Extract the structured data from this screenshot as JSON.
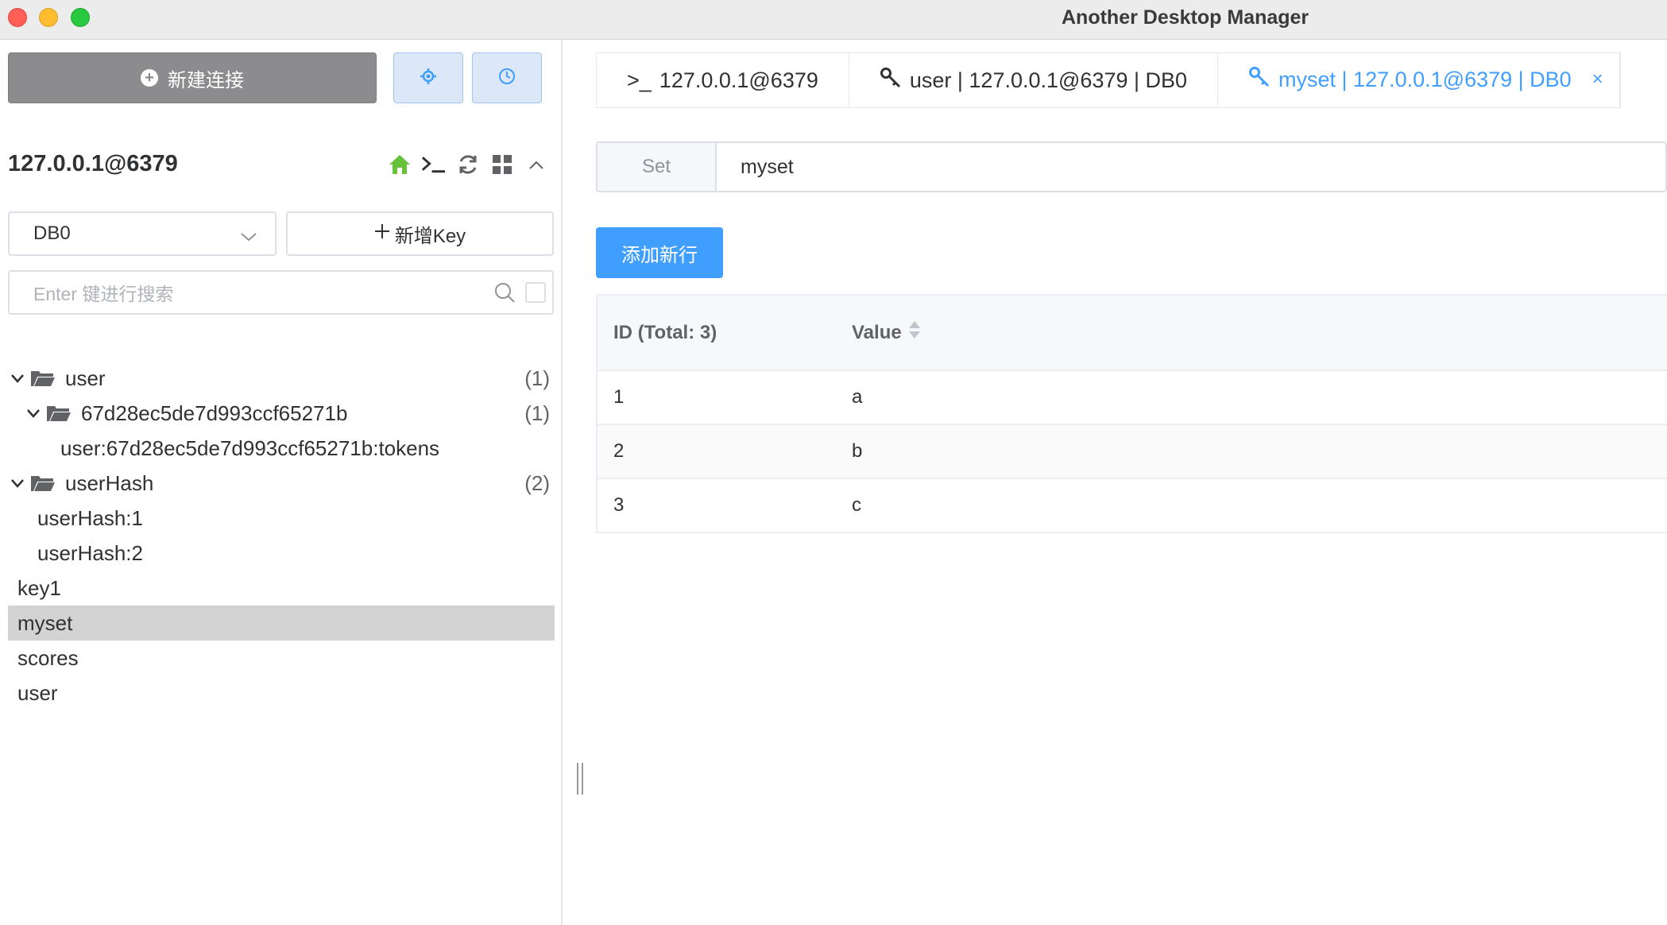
{
  "window": {
    "title": "Another Desktop Manager"
  },
  "sidebar": {
    "new_connection_label": "新建连接",
    "settings_icon": "gear-icon",
    "history_icon": "clock-icon",
    "connection_name": "127.0.0.1@6379",
    "db_select_value": "DB0",
    "new_key_label": "新增Key",
    "search_placeholder": "Enter 键进行搜索",
    "tree": [
      {
        "label": "user",
        "count": "(1)",
        "type": "folder",
        "depth": 0
      },
      {
        "label": "67d28ec5de7d993ccf65271b",
        "count": "(1)",
        "type": "folder",
        "depth": 1
      },
      {
        "label": "user:67d28ec5de7d993ccf65271b:tokens",
        "type": "key",
        "depth": 2
      },
      {
        "label": "userHash",
        "count": "(2)",
        "type": "folder",
        "depth": 0
      },
      {
        "label": "userHash:1",
        "type": "key",
        "depth": 1
      },
      {
        "label": "userHash:2",
        "type": "key",
        "depth": 1
      },
      {
        "label": "key1",
        "type": "key",
        "depth": 0
      },
      {
        "label": "myset",
        "type": "key",
        "depth": 0,
        "selected": true
      },
      {
        "label": "scores",
        "type": "key",
        "depth": 0
      },
      {
        "label": "user",
        "type": "key",
        "depth": 0
      }
    ]
  },
  "tabs": [
    {
      "prefix": ">_",
      "label": "127.0.0.1@6379"
    },
    {
      "label": "user | 127.0.0.1@6379 | DB0"
    },
    {
      "label": "myset | 127.0.0.1@6379 | DB0",
      "active": true,
      "close": "×"
    }
  ],
  "key_view": {
    "type_label": "Set",
    "key_name": "myset",
    "add_row_label": "添加新行",
    "table": {
      "headers": [
        "ID (Total: 3)",
        "Value"
      ],
      "rows": [
        [
          "1",
          "a"
        ],
        [
          "2",
          "b"
        ],
        [
          "3",
          "c"
        ]
      ]
    }
  },
  "colors": {
    "accent": "#409eff",
    "home_icon": "#67c23a",
    "selected_row": "#d3d3d3"
  }
}
